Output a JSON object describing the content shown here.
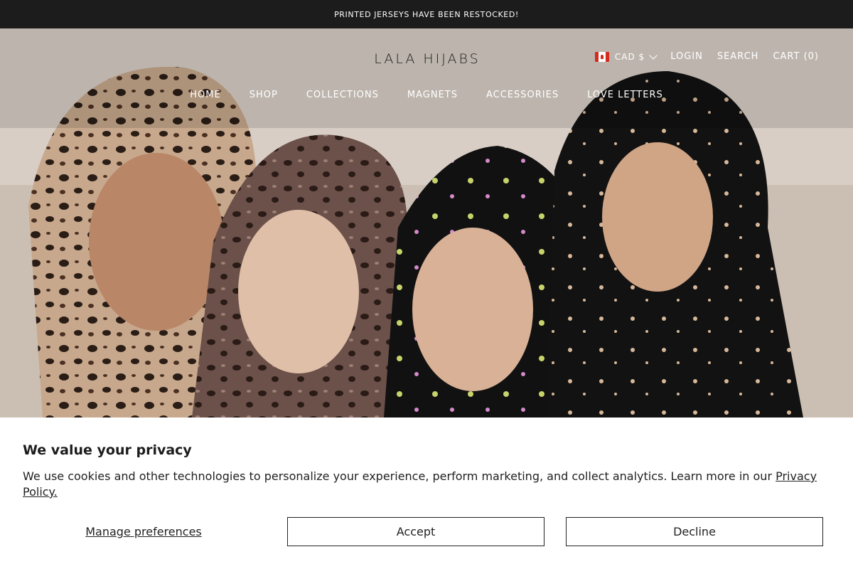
{
  "announcement": "PRINTED JERSEYS HAVE BEEN RESTOCKED!",
  "header": {
    "logo": "LALA HIJABS",
    "currency": "CAD $",
    "login": "LOGIN",
    "search": "SEARCH",
    "cart": "CART (0)"
  },
  "nav": {
    "items": [
      {
        "label": "HOME"
      },
      {
        "label": "SHOP"
      },
      {
        "label": "COLLECTIONS"
      },
      {
        "label": "MAGNETS"
      },
      {
        "label": "ACCESSORIES"
      },
      {
        "label": "LOVE LETTERS"
      }
    ]
  },
  "cookie_banner": {
    "title": "We value your privacy",
    "body": "We use cookies and other technologies to personalize your experience, perform marketing, and collect analytics. Learn more in our ",
    "link": "Privacy Policy.",
    "manage": "Manage preferences",
    "accept": "Accept",
    "decline": "Decline"
  },
  "colors": {
    "announcement_bg": "#1c1c1c",
    "text": "#1c1c1c",
    "flag_red": "#d52b1e"
  },
  "icons": [
    "canada-flag-icon",
    "chevron-down-icon"
  ]
}
